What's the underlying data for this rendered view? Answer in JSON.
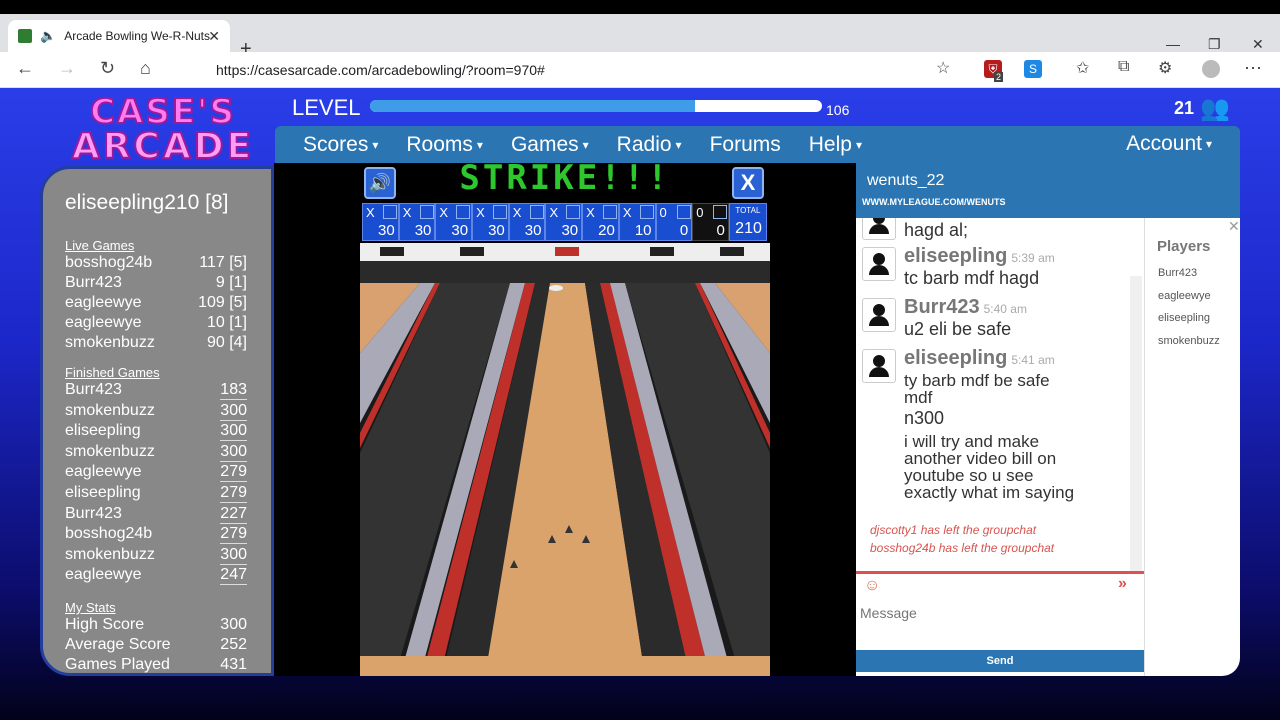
{
  "browser": {
    "tab_title": "Arcade Bowling We-R-Nuts",
    "url": "https://casesarcade.com/arcadebowling/?room=970#",
    "ext_badge": "2"
  },
  "site": {
    "logo_line1": "CASE'S",
    "logo_line2": "ARCADE",
    "level_label": "LEVEL",
    "level_value": "106",
    "level_progress_fraction": 0.72,
    "online_count": "21",
    "menu": [
      {
        "label": "Scores",
        "dropdown": true
      },
      {
        "label": "Rooms",
        "dropdown": true
      },
      {
        "label": "Games",
        "dropdown": true
      },
      {
        "label": "Radio",
        "dropdown": true
      },
      {
        "label": "Forums",
        "dropdown": false
      },
      {
        "label": "Help",
        "dropdown": true
      }
    ],
    "account_label": "Account"
  },
  "sidebar": {
    "user": "eliseepling210   [8]",
    "live_heading": "Live Games",
    "live_games": [
      {
        "name": "bosshog24b",
        "score": "117 [5]"
      },
      {
        "name": "Burr423",
        "score": "9 [1]"
      },
      {
        "name": "eagleewye",
        "score": "109 [5]"
      },
      {
        "name": "eagleewye",
        "score": "10 [1]"
      },
      {
        "name": "smokenbuzz",
        "score": "90 [4]"
      }
    ],
    "finished_heading": "Finished Games",
    "finished_games": [
      {
        "name": "Burr423",
        "score": "183"
      },
      {
        "name": "smokenbuzz",
        "score": "300"
      },
      {
        "name": "eliseepling",
        "score": "300"
      },
      {
        "name": "smokenbuzz",
        "score": "300"
      },
      {
        "name": "eagleewye",
        "score": "279"
      },
      {
        "name": "eliseepling",
        "score": "279"
      },
      {
        "name": "Burr423",
        "score": "227"
      },
      {
        "name": "bosshog24b",
        "score": "279"
      },
      {
        "name": "smokenbuzz",
        "score": "300"
      },
      {
        "name": "eagleewye",
        "score": "247"
      }
    ],
    "stats_heading": "My Stats",
    "stats": [
      {
        "name": "High Score",
        "score": "300"
      },
      {
        "name": "Average Score",
        "score": "252"
      },
      {
        "name": "Games Played",
        "score": "431"
      }
    ]
  },
  "game": {
    "banner": "STRIKE!!!",
    "frames": [
      {
        "b1": "X",
        "b2": "",
        "total": "30"
      },
      {
        "b1": "X",
        "b2": "",
        "total": "30"
      },
      {
        "b1": "X",
        "b2": "",
        "total": "30"
      },
      {
        "b1": "X",
        "b2": "",
        "total": "30"
      },
      {
        "b1": "X",
        "b2": "",
        "total": "30"
      },
      {
        "b1": "X",
        "b2": "",
        "total": "30"
      },
      {
        "b1": "X",
        "b2": "",
        "total": "20"
      },
      {
        "b1": "X",
        "b2": "",
        "total": "10"
      },
      {
        "b1": "0",
        "b2": "",
        "total": "0"
      },
      {
        "b1": "0",
        "b2": "",
        "total": "0"
      }
    ],
    "total_label": "TOTAL",
    "total_score": "210"
  },
  "chat": {
    "host_name": "wenuts_22",
    "host_url": "WWW.MYLEAGUE.COM/WENUTS",
    "partial_top_text": "hagd al;",
    "messages": [
      {
        "user": "eliseepling",
        "time": "5:39 am",
        "lines": [
          "tc barb mdf hagd"
        ]
      },
      {
        "user": "Burr423",
        "time": "5:40 am",
        "lines": [
          "u2 eli be safe"
        ]
      },
      {
        "user": "eliseepling",
        "time": "5:41 am",
        "lines": [
          "ty barb mdf be safe mdf",
          "n300",
          "i will try and make another video bill on youtube so u see exactly what im saying"
        ]
      }
    ],
    "system": [
      "djscotty1 has left the groupchat",
      "bosshog24b has left the groupchat"
    ],
    "input_placeholder": "Message",
    "send_label": "Send",
    "players_heading": "Players",
    "players": [
      "Burr423",
      "eagleewye",
      "eliseepling",
      "smokenbuzz"
    ]
  }
}
